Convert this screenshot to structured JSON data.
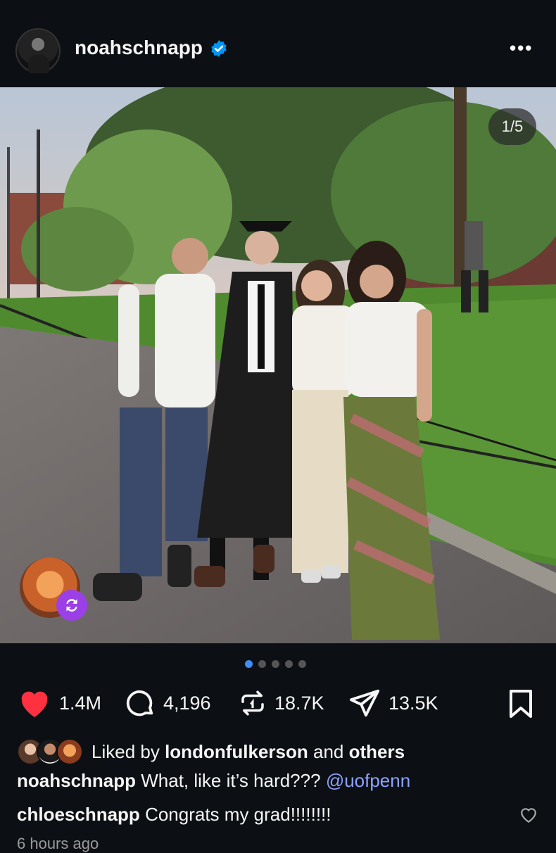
{
  "post": {
    "username": "noahschnapp",
    "verified": true,
    "slide_counter": "1/5",
    "dots_total": 5,
    "active_dot": 0
  },
  "actions": {
    "likes": "1.4M",
    "comments": "4,196",
    "reposts": "18.7K",
    "shares": "13.5K"
  },
  "liked_by": {
    "prefix": "Liked by",
    "user": "londonfulkerson",
    "connector": "and",
    "others": "others"
  },
  "caption": {
    "username": "noahschnapp",
    "text": "What, like it’s hard???",
    "mention": "@uofpenn"
  },
  "comment": {
    "username": "chloeschnapp",
    "text": "Congrats my grad!!!!!!!!"
  },
  "timestamp": "6 hours ago",
  "colors": {
    "background": "#0c1014",
    "like_red": "#ff3040",
    "verified_blue": "#0095f6",
    "active_dot": "#3f8ef7",
    "mention": "#8ea2ff",
    "remix_purple": "#9b3fe6"
  },
  "icons": {
    "like": "heart-icon",
    "comment": "comment-bubble-icon",
    "repost": "repost-icon",
    "share": "paper-plane-icon",
    "save": "bookmark-icon",
    "more": "more-dots-icon",
    "remix": "remix-icon"
  }
}
